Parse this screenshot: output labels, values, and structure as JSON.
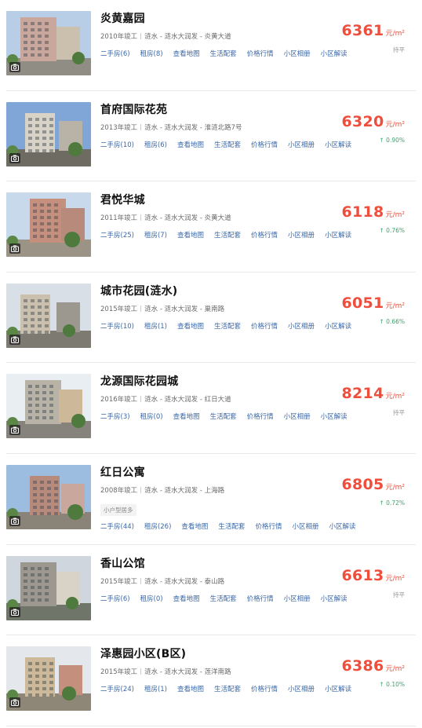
{
  "listings": [
    {
      "name": "炎黄嘉园",
      "year": "2010年竣工",
      "location": "涟水 - 涟水大润发 - 炎黄大道",
      "tag": "",
      "links": [
        "二手房(6)",
        "租房(8)",
        "查看地图",
        "生活配套",
        "价格行情",
        "小区相册",
        "小区解读"
      ],
      "price": "6361",
      "unit": "元/m²",
      "change": "持平",
      "trend": "flat",
      "photo": "building-photo-1"
    },
    {
      "name": "首府国际花苑",
      "year": "2013年竣工",
      "location": "涟水 - 涟水大润发 - 淮涟北路7号",
      "tag": "",
      "links": [
        "二手房(10)",
        "租房(6)",
        "查看地图",
        "生活配套",
        "价格行情",
        "小区相册",
        "小区解读"
      ],
      "price": "6320",
      "unit": "元/m²",
      "change": "0.90%",
      "trend": "up",
      "photo": "building-photo-2"
    },
    {
      "name": "君悦华城",
      "year": "2011年竣工",
      "location": "涟水 - 涟水大润发 - 炎黄大道",
      "tag": "",
      "links": [
        "二手房(25)",
        "租房(7)",
        "查看地图",
        "生活配套",
        "价格行情",
        "小区相册",
        "小区解读"
      ],
      "price": "6118",
      "unit": "元/m²",
      "change": "0.76%",
      "trend": "up",
      "photo": "building-photo-3"
    },
    {
      "name": "城市花园(涟水)",
      "year": "2015年竣工",
      "location": "涟水 - 涟水大润发 - 巢南路",
      "tag": "",
      "links": [
        "二手房(10)",
        "租房(1)",
        "查看地图",
        "生活配套",
        "价格行情",
        "小区相册",
        "小区解读"
      ],
      "price": "6051",
      "unit": "元/m²",
      "change": "0.66%",
      "trend": "up",
      "photo": "building-photo-4"
    },
    {
      "name": "龙源国际花园城",
      "year": "2016年竣工",
      "location": "涟水 - 涟水大润发 - 红日大道",
      "tag": "",
      "links": [
        "二手房(3)",
        "租房(0)",
        "查看地图",
        "生活配套",
        "价格行情",
        "小区相册",
        "小区解读"
      ],
      "price": "8214",
      "unit": "元/m²",
      "change": "持平",
      "trend": "flat",
      "photo": "building-photo-5"
    },
    {
      "name": "红日公寓",
      "year": "2008年竣工",
      "location": "涟水 - 涟水大润发 - 上海路",
      "tag": "小户型居多",
      "links": [
        "二手房(44)",
        "租房(26)",
        "查看地图",
        "生活配套",
        "价格行情",
        "小区相册",
        "小区解读"
      ],
      "price": "6805",
      "unit": "元/m²",
      "change": "0.72%",
      "trend": "up",
      "photo": "building-photo-6"
    },
    {
      "name": "香山公馆",
      "year": "2015年竣工",
      "location": "涟水 - 涟水大润发 - 泰山路",
      "tag": "",
      "links": [
        "二手房(6)",
        "租房(0)",
        "查看地图",
        "生活配套",
        "价格行情",
        "小区相册",
        "小区解读"
      ],
      "price": "6613",
      "unit": "元/m²",
      "change": "持平",
      "trend": "flat",
      "photo": "building-photo-7"
    },
    {
      "name": "泽惠园小区(B区)",
      "year": "2015年竣工",
      "location": "涟水 - 涟水大润发 - 莲洋南路",
      "tag": "",
      "links": [
        "二手房(24)",
        "租房(1)",
        "查看地图",
        "生活配套",
        "价格行情",
        "小区相册",
        "小区解读"
      ],
      "price": "6386",
      "unit": "元/m²",
      "change": "0.10%",
      "trend": "up",
      "photo": "building-photo-8"
    }
  ],
  "colors": {
    "price": "#ef4e3c",
    "link": "#3b68a8",
    "up": "#3aa56a",
    "flat": "#999999"
  },
  "icons": {
    "photo_badge": "camera-icon",
    "up_arrow": "up-arrow-icon"
  }
}
